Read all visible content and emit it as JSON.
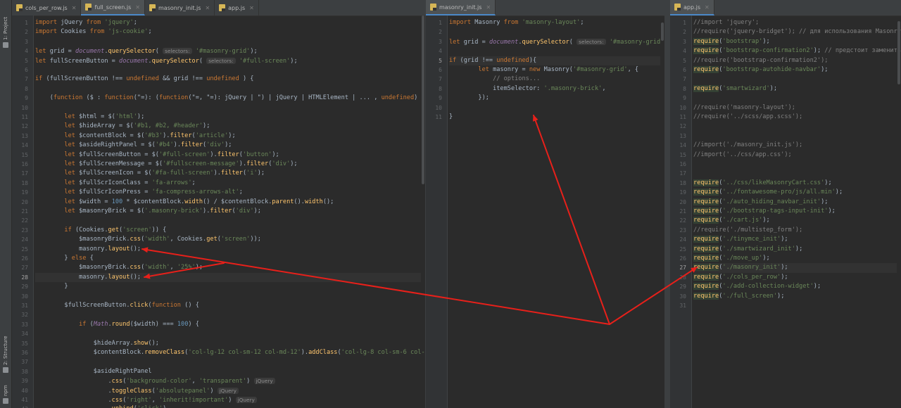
{
  "tool_window": {
    "tabs": [
      "1: Project",
      "2: Structure",
      "npm"
    ]
  },
  "panes": [
    {
      "tabs": [
        {
          "label": "cols_per_row.js",
          "active": false
        },
        {
          "label": "full_screen.js",
          "active": true
        },
        {
          "label": "masonry_init.js",
          "active": false
        },
        {
          "label": "app.js",
          "active": false
        }
      ],
      "line_numbers": [
        "1",
        "2",
        "3",
        "4",
        "5",
        "6",
        "7",
        "8",
        "9",
        "10",
        "11",
        "12",
        "13",
        "14",
        "15",
        "16",
        "17",
        "18",
        "19",
        "20",
        "21",
        "22",
        "23",
        "24",
        "25",
        "26",
        "27",
        "28",
        "29",
        "30",
        "31",
        "32",
        "33",
        "34",
        "35",
        "36",
        "37",
        "38",
        "39",
        "40",
        "41",
        "42"
      ],
      "current_line": "28",
      "lines": [
        "import jQuery from 'jquery';",
        "import Cookies from 'js-cookie';",
        "",
        "let grid = document.querySelector( selectors: '#masonry-grid');",
        "let fullScreenButton = document.querySelector( selectors: '#full-screen');",
        "",
        "if (fullScreenButton !== undefined && grid !== undefined ) {",
        "",
        "    (function ($ : function(\"=): (function(\"=, \"=): jQuery | \") | jQuery | HTMLElement | ... , undefined) {",
        "",
        "        let $html = $('html');",
        "        let $hideArray = $('#b1, #b2, #header');",
        "        let $contentBlock = $('#b3').filter('article');",
        "        let $asideRightPanel = $('#b4').filter('div');",
        "        let $fullScreenButton = $('#full-screen').filter('button');",
        "        let $fullScreenMessage = $('#fullscreen-message').filter('div');",
        "        let $fullScreenIcon = $('#fa-full-screen').filter('i');",
        "        let $fullScrIconClass = 'fa-arrows';",
        "        let $fullScrIconPress = 'fa-compress-arrows-alt';",
        "        let $width = 100 * $contentBlock.width() / $contentBlock.parent().width();",
        "        let $masonryBrick = $('.masonry-brick').filter('div');",
        "",
        "        if (Cookies.get('screen')) {",
        "            $masonryBrick.css('width', Cookies.get('screen'));",
        "            masonry.layout();",
        "        } else {",
        "            $masonryBrick.css('width', '25%');",
        "            masonry.layout();",
        "        }",
        "",
        "        $fullScreenButton.click(function () {",
        "",
        "            if (Math.round($width) === 100) {",
        "",
        "                $hideArray.show();",
        "                $contentBlock.removeClass('col-lg-12 col-sm-12 col-md-12').addClass('col-lg-8 col-sm-6 col-md-8');",
        "",
        "                $asideRightPanel",
        "                    .css('background-color', 'transparent') jQuery",
        "                    .toggleClass('absolutepanel') jQuery",
        "                    .css('right', 'inherit!important') jQuery",
        "                    .unbind('click')"
      ]
    },
    {
      "tabs": [
        {
          "label": "masonry_init.js",
          "active": true
        }
      ],
      "line_numbers": [
        "1",
        "2",
        "3",
        "4",
        "5",
        "6",
        "7",
        "8",
        "9",
        "10",
        "11"
      ],
      "current_line": "5",
      "lines": [
        "import Masonry from 'masonry-layout';",
        "",
        "let grid = document.querySelector( selectors: '#masonry-grid');",
        "",
        "if (grid !== undefined){",
        "        let masonry = new Masonry('#masonry-grid', {",
        "            // options...",
        "            itemSelector: '.masonry-brick',",
        "        });",
        "",
        "}"
      ]
    },
    {
      "tabs": [
        {
          "label": "app.js",
          "active": true
        }
      ],
      "line_numbers": [
        "1",
        "2",
        "3",
        "4",
        "5",
        "6",
        "7",
        "8",
        "9",
        "10",
        "11",
        "12",
        "13",
        "14",
        "15",
        "16",
        "17",
        "18",
        "19",
        "20",
        "21",
        "22",
        "23",
        "24",
        "25",
        "26",
        "27",
        "28",
        "29",
        "30",
        "31"
      ],
      "current_line": "27",
      "lines": [
        "//import 'jquery';",
        "//require('jquery-bridget'); // для использования Masonry",
        "require('bootstrap');",
        "require('bootstrap-confirmation2'); // предстоит заменить на",
        "//require('bootstrap-confirmation2');",
        "require('bootstrap-autohide-navbar');",
        "",
        "require('smartwizard');",
        "",
        "//require('masonry-layout');",
        "//require('../scss/app.scss');",
        "",
        "",
        "//import('./masonry_init.js');",
        "//import('../css/app.css');",
        "",
        "",
        "require('../css/likeMasonryCart.css');",
        "require('../fontawesome-pro/js/all.min');",
        "require('./auto_hiding_navbar_init');",
        "require('./bootstrap-tags-input-init');",
        "require('./cart.js');",
        "//require('./multistep_form');",
        "require('./tinymce_init');",
        "require('./smartwizard_init');",
        "require('./move_up');",
        "require('./masonry_init');",
        "require('./cols_per_row');",
        "require('./add-collection-widget');",
        "require('./full_screen');",
        ""
      ]
    }
  ],
  "annotation": {
    "arrow_color": "#e8201a"
  }
}
